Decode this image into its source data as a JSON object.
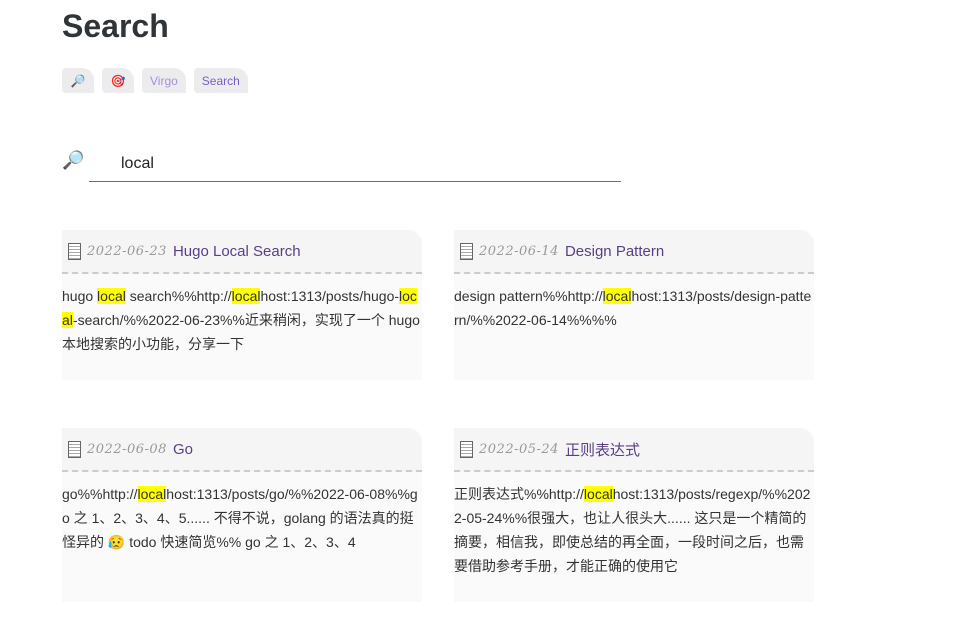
{
  "page": {
    "title": "Search"
  },
  "tags": [
    {
      "label": "🔎",
      "icon": "magnifier-icon"
    },
    {
      "label": "🎯",
      "icon": "target-icon"
    },
    {
      "label": "Virgo"
    },
    {
      "label": "Search"
    }
  ],
  "search": {
    "icon": "🔎",
    "value": "local"
  },
  "results": [
    {
      "date": "2022-06-23",
      "title": "Hugo Local Search",
      "snippet": [
        {
          "t": "hugo "
        },
        {
          "t": "local",
          "hl": true
        },
        {
          "t": " search%%http://"
        },
        {
          "t": "local",
          "hl": true
        },
        {
          "t": "host:1313/posts/hugo-"
        },
        {
          "t": "local",
          "hl": true
        },
        {
          "t": "-search/%%2022-06-23%%近来稍闲，实现了一个 hugo 本地搜索的小功能，分享一下"
        }
      ]
    },
    {
      "date": "2022-06-14",
      "title": "Design Pattern",
      "snippet": [
        {
          "t": "design pattern%%http://"
        },
        {
          "t": "local",
          "hl": true
        },
        {
          "t": "host:1313/posts/design-pattern/%%2022-06-14%%%%"
        }
      ]
    },
    {
      "date": "2022-06-08",
      "title": "Go",
      "snippet": [
        {
          "t": "go%%http://"
        },
        {
          "t": "local",
          "hl": true
        },
        {
          "t": "host:1313/posts/go/%%2022-06-08%%go 之 1、2、3、4、5...... 不得不说，golang 的语法真的挺怪异的 😥 todo 快速简览%% go 之 1、2、3、4"
        }
      ]
    },
    {
      "date": "2022-05-24",
      "title": "正则表达式",
      "snippet": [
        {
          "t": "正则表达式%%http://"
        },
        {
          "t": "local",
          "hl": true
        },
        {
          "t": "host:1313/posts/regexp/%%2022-05-24%%很强大，也让人很头大...... 这只是一个精简的摘要，相信我，即使总结的再全面，一段时间之后，也需要借助参考手册，才能正确的使用它"
        }
      ]
    }
  ]
}
